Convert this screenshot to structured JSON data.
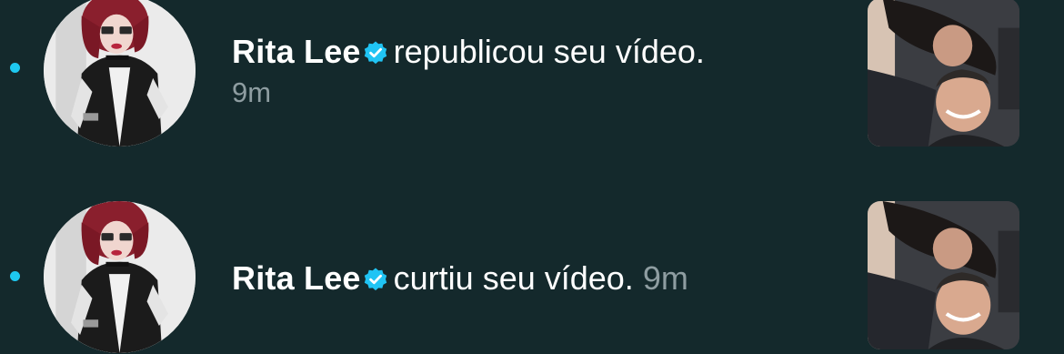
{
  "notifications": [
    {
      "user_name": "Rita Lee",
      "verified": true,
      "action": "republicou seu vídeo.",
      "time": "9m",
      "unread": true
    },
    {
      "user_name": "Rita Lee",
      "verified": true,
      "action": "curtiu seu vídeo.",
      "time": "9m",
      "unread": true
    }
  ],
  "colors": {
    "background": "#14292c",
    "unread_dot": "#1ec8f0",
    "verified_badge": "#20c4f4",
    "primary_text": "#ffffff",
    "secondary_text": "#8e9da1"
  },
  "icons": {
    "verified": "verified-check-icon",
    "unread": "unread-dot"
  }
}
